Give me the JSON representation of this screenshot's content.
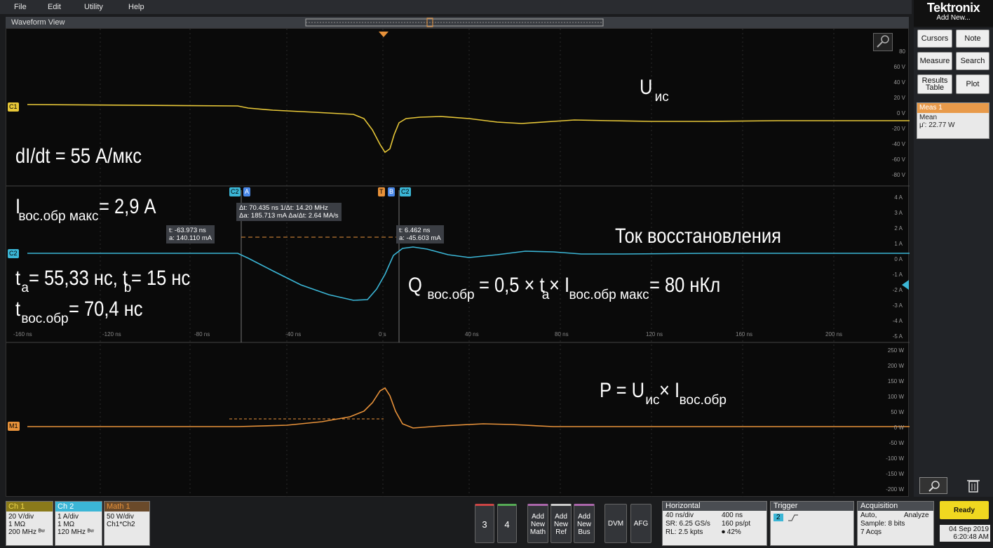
{
  "menu": [
    "File",
    "Edit",
    "Utility",
    "Help"
  ],
  "brand": {
    "name": "Tektronix",
    "add_new": "Add New..."
  },
  "waveform_view": {
    "title": "Waveform View"
  },
  "side_buttons": [
    {
      "label": "Cursors"
    },
    {
      "label": "Note"
    },
    {
      "label": "Measure"
    },
    {
      "label": "Search"
    },
    {
      "label": "Results Table"
    },
    {
      "label": "Plot"
    }
  ],
  "meas1": {
    "title": "Meas 1",
    "line1": "Mean",
    "line2": "μ': 22.77 W"
  },
  "ch1_scale": [
    "80",
    "60 V",
    "40 V",
    "20 V",
    "0 V",
    "-20 V",
    "-40 V",
    "-60 V",
    "-80 V"
  ],
  "ch2_scale": [
    "4 A",
    "3 A",
    "2 A",
    "1 A",
    "0 A",
    "-1 A",
    "-2 A",
    "-3 A",
    "-4 A",
    "-5 A"
  ],
  "math_scale": [
    "250 W",
    "200 W",
    "150 W",
    "100 W",
    "50 W",
    "0 W",
    "-50 W",
    "-100 W",
    "-150 W",
    "-200 W"
  ],
  "time_axis": [
    "-160 ns",
    "-120 ns",
    "-80 ns",
    "-40 ns",
    "0 s",
    "40 ns",
    "80 ns",
    "120 ns",
    "160 ns",
    "200 ns"
  ],
  "channel_tags": {
    "c1": "C1",
    "c2": "C2",
    "m1": "M1"
  },
  "cursor_marks": {
    "a_ch": "C2",
    "a": "A",
    "t": "T",
    "b": "B",
    "b_ch": "C2"
  },
  "cursor_delta": {
    "line1": "Δt: 70.435 ns     1/Δt: 14.20 MHz",
    "line2": "Δa: 185.713 mA     Δa/Δt: 2.64 MA/s"
  },
  "cursor_a": {
    "t": "t: -63.973 ns",
    "a": "a: 140.110 mA"
  },
  "cursor_b": {
    "t": "t: 6.462 ns",
    "a": "a: -45.603 mA"
  },
  "annotations": {
    "u_main": "U",
    "u_sub": "ис",
    "didt": "dI/dt = 55 А/мкс",
    "imax_main": "I",
    "imax_sub": "вос.обр макс",
    "imax_val": " = 2,9 А",
    "tok": "Ток восстановления",
    "ta_t": "t",
    "ta_sub": "a",
    "ta_mid": " = 55,33 нс, t",
    "tb_sub": "b",
    "tb_val": " = 15 нс",
    "tvos_t": "t",
    "tvos_sub": "вос.обр",
    "tvos_val": " = 70,4 нс",
    "q_main": "Q",
    "q_sub": "вос.обр",
    "q_mid": " = 0,5 × t",
    "q_sub2": "a",
    "q_mid2": " × I",
    "q_sub3": "вос.обр макс",
    "q_val": " = 80 нКл",
    "p_main": "P = U",
    "p_sub": "ис",
    "p_mid": "× I",
    "p_sub2": "вос.обр"
  },
  "ch1": {
    "title": "Ch 1",
    "l1": "20 V/div",
    "l2": "1 MΩ",
    "l3": "200 MHz ᴮʷ",
    "color": "#e8c838"
  },
  "ch2": {
    "title": "Ch 2",
    "l1": "1 A/div",
    "l2": "1 MΩ",
    "l3": "120 MHz ᴮʷ",
    "color": "#3bb6d6"
  },
  "math1": {
    "title": "Math 1",
    "l1": "50 W/div",
    "l2": "Ch1*Ch2",
    "color": "#e8923a"
  },
  "bottom_buttons": {
    "b3": "3",
    "b4": "4",
    "math": "Add New Math",
    "ref": "Add New Ref",
    "bus": "Add New Bus",
    "dvm": "DVM",
    "afg": "AFG"
  },
  "horizontal": {
    "title": "Horizontal",
    "r1a": "40 ns/div",
    "r1b": "400 ns",
    "r2a": "SR: 6.25 GS/s",
    "r2b": "160 ps/pt",
    "r3a": "RL: 2.5 kpts",
    "r3b": "⏺ 42%"
  },
  "trigger": {
    "title": "Trigger",
    "ch": "2"
  },
  "acquisition": {
    "title": "Acquisition",
    "r1a": "Auto,",
    "r1b": "Analyze",
    "r2": "Sample: 8 bits",
    "r3": "7 Acqs"
  },
  "status": {
    "ready": "Ready",
    "date": "04 Sep 2019",
    "time": "6:20:48 AM"
  }
}
